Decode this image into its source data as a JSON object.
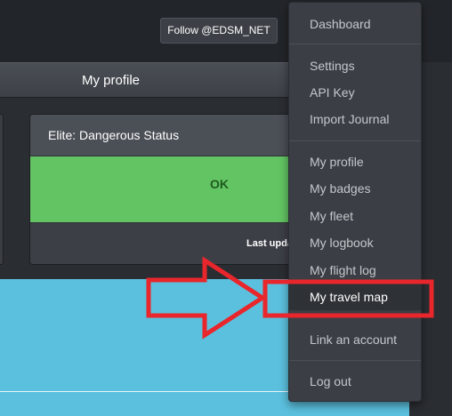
{
  "header": {
    "follow_label": "Follow @EDSM_NET"
  },
  "profile_bar": {
    "title": "My profile"
  },
  "status_panel": {
    "title": "Elite: Dangerous Status",
    "status": "OK",
    "footer": "Last upda"
  },
  "menu": {
    "items": [
      {
        "label": "Dashboard"
      },
      {
        "label": "Settings"
      },
      {
        "label": "API Key"
      },
      {
        "label": "Import Journal"
      },
      {
        "label": "My profile"
      },
      {
        "label": "My badges"
      },
      {
        "label": "My fleet"
      },
      {
        "label": "My logbook"
      },
      {
        "label": "My flight log"
      },
      {
        "label": "My travel map"
      },
      {
        "label": "Link an account"
      },
      {
        "label": "Log out"
      }
    ],
    "active_item": "My travel map"
  },
  "colors": {
    "annotation_red": "#e8262b",
    "status_ok": "#62c462",
    "map_blue": "#5bc0de"
  }
}
